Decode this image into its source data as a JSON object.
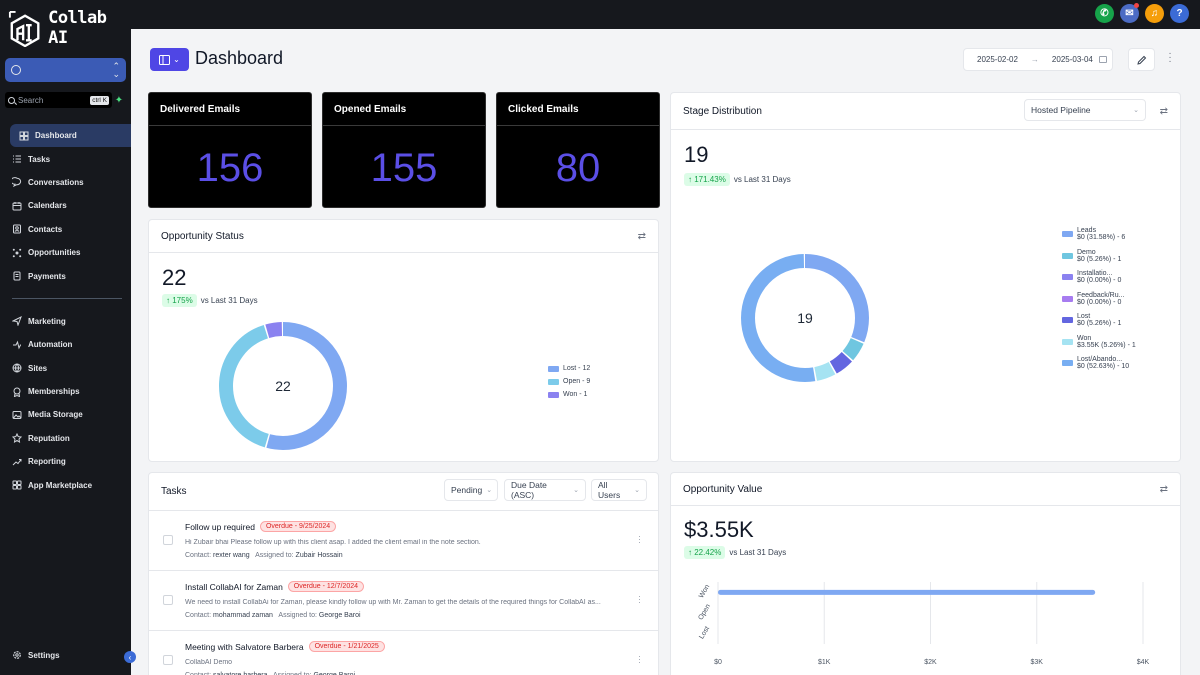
{
  "app": {
    "logo_text": "Collab AI"
  },
  "sidebar": {
    "search_placeholder": "Search",
    "search_shortcut": "ctrl K",
    "items_top": [
      {
        "label": "Dashboard",
        "icon": "dashboard-icon",
        "active": true
      },
      {
        "label": "Tasks",
        "icon": "tasks-icon"
      },
      {
        "label": "Conversations",
        "icon": "chat-icon"
      },
      {
        "label": "Calendars",
        "icon": "calendar-icon"
      },
      {
        "label": "Contacts",
        "icon": "contacts-icon"
      },
      {
        "label": "Opportunities",
        "icon": "opportunities-icon"
      },
      {
        "label": "Payments",
        "icon": "payments-icon"
      }
    ],
    "items_bottom": [
      {
        "label": "Marketing",
        "icon": "send-icon"
      },
      {
        "label": "Automation",
        "icon": "automation-icon"
      },
      {
        "label": "Sites",
        "icon": "globe-icon"
      },
      {
        "label": "Memberships",
        "icon": "membership-icon"
      },
      {
        "label": "Media Storage",
        "icon": "image-icon"
      },
      {
        "label": "Reputation",
        "icon": "star-icon"
      },
      {
        "label": "Reporting",
        "icon": "chart-line-icon"
      },
      {
        "label": "App Marketplace",
        "icon": "grid-icon"
      }
    ],
    "settings_label": "Settings"
  },
  "topbar": {
    "icons": [
      "phone-icon",
      "megaphone-icon",
      "bell-icon",
      "help-icon"
    ],
    "colors": [
      "#16a34a",
      "#4b6bc4",
      "#f59e0b",
      "#3b6bd6"
    ]
  },
  "header": {
    "title": "Dashboard",
    "date_from": "2025-02-02",
    "date_to": "2025-03-04"
  },
  "stats": [
    {
      "label": "Delivered Emails",
      "value": "156"
    },
    {
      "label": "Opened Emails",
      "value": "155"
    },
    {
      "label": "Clicked Emails",
      "value": "80"
    }
  ],
  "opportunity_status": {
    "title": "Opportunity Status",
    "total": "22",
    "change": "↑ 175%",
    "vs": "vs Last 31 Days",
    "center": "22",
    "slices": [
      {
        "label": "Lost - 12",
        "value": 12,
        "color": "#7fa8f2"
      },
      {
        "label": "Open - 9",
        "value": 9,
        "color": "#7ccbea"
      },
      {
        "label": "Won - 1",
        "value": 1,
        "color": "#8b82f0"
      }
    ]
  },
  "stage_distribution": {
    "title": "Stage Distribution",
    "pipeline": "Hosted Pipeline",
    "total": "19",
    "change": "↑ 171.43%",
    "vs": "vs Last 31 Days",
    "center": "19",
    "slices": [
      {
        "name": "Leads",
        "detail": "$0 (31.58%) - 6",
        "value": 6,
        "color": "#7fa8f2"
      },
      {
        "name": "Demo",
        "detail": "$0 (5.26%) - 1",
        "value": 1,
        "color": "#6fc6e0"
      },
      {
        "name": "Installatio...",
        "detail": "$0 (0.00%) - 0",
        "value": 0,
        "color": "#8b82f0"
      },
      {
        "name": "Feedback/Ru...",
        "detail": "$0 (0.00%) - 0",
        "value": 0,
        "color": "#a77cf0"
      },
      {
        "name": "Lost",
        "detail": "$0 (5.26%) - 1",
        "value": 1,
        "color": "#6366e0"
      },
      {
        "name": "Won",
        "detail": "$3.55K (5.26%) - 1",
        "value": 1,
        "color": "#a5e3f2"
      },
      {
        "name": "Lost/Abando...",
        "detail": "$0 (52.63%) - 10",
        "value": 10,
        "color": "#78aef2"
      }
    ]
  },
  "tasks": {
    "title": "Tasks",
    "filter_status": "Pending",
    "filter_sort": "Due Date (ASC)",
    "filter_users": "All Users",
    "items": [
      {
        "title": "Follow up required",
        "badge": "Overdue - 9/25/2024",
        "desc": "Hi Zubair bhai Please follow up with this client asap. I added the client email in the note section.",
        "contact_label": "Contact:",
        "contact": "rexter wang",
        "assigned_label": "Assigned to:",
        "assigned": "Zubair Hossain"
      },
      {
        "title": "Install CollabAI for Zaman",
        "badge": "Overdue - 12/7/2024",
        "desc": "We need to install CollabAi for Zaman, please kindly follow up with Mr. Zaman to get the details of the required things for CollabAI as...",
        "contact_label": "Contact:",
        "contact": "mohammad zaman",
        "assigned_label": "Assigned to:",
        "assigned": "George Baroi"
      },
      {
        "title": "Meeting with Salvatore Barbera",
        "badge": "Overdue - 1/21/2025",
        "desc": "CollabAI Demo",
        "contact_label": "Contact:",
        "contact": "salvatore barbera",
        "assigned_label": "Assigned to:",
        "assigned": "George Baroi"
      }
    ]
  },
  "opportunity_value": {
    "title": "Opportunity Value",
    "total": "$3.55K",
    "change": "↑ 22.42%",
    "vs": "vs Last 31 Days",
    "chart_data": {
      "type": "bar",
      "orientation": "horizontal",
      "categories": [
        "Won",
        "Open",
        "Lost"
      ],
      "values": [
        3550,
        0,
        0
      ],
      "xlim": [
        0,
        4000
      ],
      "xticks": [
        "$0",
        "$1K",
        "$2K",
        "$3K",
        "$4K"
      ],
      "grid": true,
      "color": "#7fa8f2"
    }
  }
}
